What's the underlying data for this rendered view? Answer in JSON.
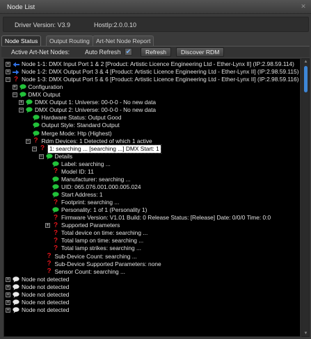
{
  "window": {
    "title": "Node List"
  },
  "info": {
    "driver_version": "Driver Version: V3.9",
    "host_ip": "HostIp:2.0.0.10"
  },
  "tabs": [
    "Node Status",
    "Output Routing",
    "Art-Net Node Report"
  ],
  "toolbar": {
    "active_nodes_label": "Active Art-Net Nodes:",
    "auto_refresh_label": "Auto Refresh",
    "auto_refresh_checked": true,
    "refresh_button": "Refresh",
    "discover_button": "Discover RDM"
  },
  "colors": {
    "green": "#22c23a",
    "blue": "#2f6fe0",
    "red": "#e0141b",
    "white": "#e8e8e8",
    "accent": "#3d86d6"
  },
  "tree": [
    {
      "depth": 0,
      "expander": "+",
      "icon": "arrow-left-icon",
      "text": "Node 1-1: DMX Input Port 1 & 2 [Product: Artistic Licence Engineering Ltd - Ether-Lynx II] (IP:2.98.59.114)"
    },
    {
      "depth": 0,
      "expander": "+",
      "icon": "arrow-right-icon",
      "text": "Node 1-2: DMX Output Port 3 & 4 [Product: Artistic Licence Engineering Ltd - Ether-Lynx II] (IP:2.98.59.115)"
    },
    {
      "depth": 0,
      "expander": "-",
      "icon": "question-icon",
      "text": "Node 1-3: DMX Output Port 5 & 6 [Product: Artistic Licence Engineering Ltd - Ether-Lynx II] (IP:2.98.59.116)"
    },
    {
      "depth": 1,
      "expander": "+",
      "icon": "green-bubble-icon",
      "text": "Configuration"
    },
    {
      "depth": 1,
      "expander": "-",
      "icon": "green-bubble-icon",
      "text": "DMX Output"
    },
    {
      "depth": 2,
      "expander": "+",
      "icon": "green-bubble-icon",
      "text": "DMX Output 1: Universe: 00-0-0 - No new data"
    },
    {
      "depth": 2,
      "expander": "-",
      "icon": "green-bubble-icon",
      "text": "DMX Output 2: Universe: 00-0-0 - No new data"
    },
    {
      "depth": 3,
      "expander": "",
      "icon": "green-bubble-icon",
      "text": "Hardware Status: Output Good"
    },
    {
      "depth": 3,
      "expander": "",
      "icon": "green-bubble-icon",
      "text": "Output Style: Standard Output"
    },
    {
      "depth": 3,
      "expander": "",
      "icon": "green-bubble-icon",
      "text": "Merge Mode: Htp (Highest)"
    },
    {
      "depth": 3,
      "expander": "-",
      "icon": "question-icon",
      "text": "Rdm Devices: 1 Detected of which 1 active"
    },
    {
      "depth": 4,
      "expander": "-",
      "icon": "question-icon",
      "text": "1: searching ... [searching ...] DMX Start: 1",
      "selected": true
    },
    {
      "depth": 5,
      "expander": "-",
      "icon": "green-bubble-icon",
      "text": "Details"
    },
    {
      "depth": 6,
      "expander": "",
      "icon": "green-bubble-icon",
      "text": "Label: searching ..."
    },
    {
      "depth": 6,
      "expander": "",
      "icon": "question-icon",
      "text": "Model ID: 11"
    },
    {
      "depth": 6,
      "expander": "",
      "icon": "green-bubble-icon",
      "text": "Manufacturer: searching ..."
    },
    {
      "depth": 6,
      "expander": "",
      "icon": "green-bubble-icon",
      "text": "UID: 065.076.001.000.005.024"
    },
    {
      "depth": 6,
      "expander": "",
      "icon": "green-bubble-icon",
      "text": "Start Address: 1"
    },
    {
      "depth": 6,
      "expander": "",
      "icon": "question-icon",
      "text": "Footprint: searching ..."
    },
    {
      "depth": 6,
      "expander": "",
      "icon": "green-bubble-icon",
      "text": "Personality: 1 of 1 (Personality 1)"
    },
    {
      "depth": 6,
      "expander": "",
      "icon": "question-icon",
      "text": "Firmware Version: V1.01 Build: 0 Release Status: [Release] Date: 0/0/0 Time: 0:0"
    },
    {
      "depth": 6,
      "expander": "+",
      "icon": "question-icon",
      "text": "Supported Parameters"
    },
    {
      "depth": 6,
      "expander": "",
      "icon": "question-icon",
      "text": "Total device on time: searching ..."
    },
    {
      "depth": 6,
      "expander": "",
      "icon": "question-icon",
      "text": "Total lamp on time: searching ..."
    },
    {
      "depth": 6,
      "expander": "",
      "icon": "question-icon",
      "text": "Total lamp strikes: searching ..."
    },
    {
      "depth": 5,
      "expander": "",
      "icon": "question-icon",
      "text": "Sub-Device Count: searching ..."
    },
    {
      "depth": 5,
      "expander": "",
      "icon": "question-icon",
      "text": "Sub-Device Supported Parameters: none"
    },
    {
      "depth": 5,
      "expander": "",
      "icon": "question-icon",
      "text": "Sensor Count: searching ..."
    },
    {
      "depth": 0,
      "expander": "+",
      "icon": "white-bubble-icon",
      "text": "Node not detected"
    },
    {
      "depth": 0,
      "expander": "+",
      "icon": "white-bubble-icon",
      "text": "Node not detected"
    },
    {
      "depth": 0,
      "expander": "+",
      "icon": "white-bubble-icon",
      "text": "Node not detected"
    },
    {
      "depth": 0,
      "expander": "+",
      "icon": "white-bubble-icon",
      "text": "Node not detected"
    },
    {
      "depth": 0,
      "expander": "+",
      "icon": "white-bubble-icon",
      "text": "Node not detected"
    }
  ]
}
